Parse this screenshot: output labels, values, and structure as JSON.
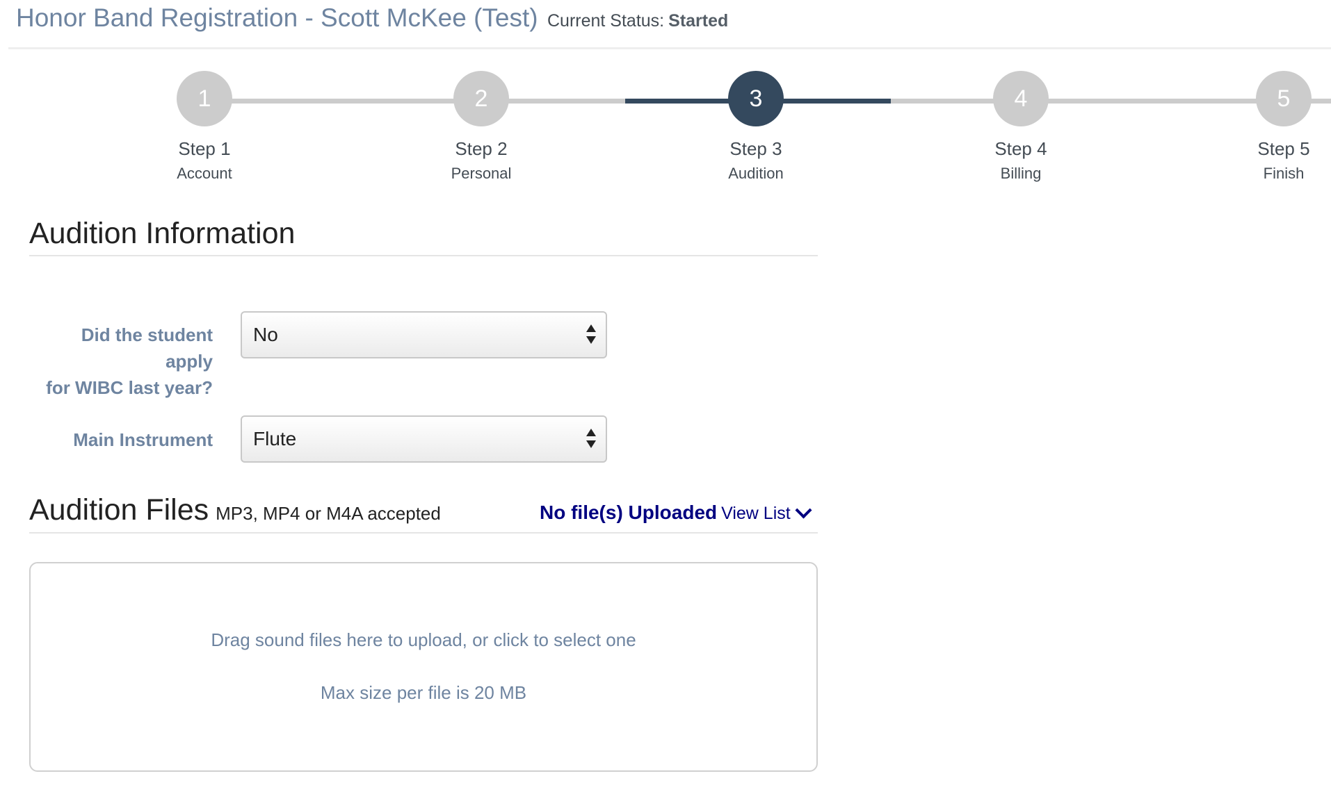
{
  "header": {
    "title": "Honor Band Registration - Scott McKee (Test)",
    "status_label": "Current Status:",
    "status_value": "Started"
  },
  "steps": [
    {
      "number": "1",
      "title": "Step 1",
      "subtitle": "Account",
      "active": false
    },
    {
      "number": "2",
      "title": "Step 2",
      "subtitle": "Personal",
      "active": false
    },
    {
      "number": "3",
      "title": "Step 3",
      "subtitle": "Audition",
      "active": true
    },
    {
      "number": "4",
      "title": "Step 4",
      "subtitle": "Billing",
      "active": false
    },
    {
      "number": "5",
      "title": "Step 5",
      "subtitle": "Finish",
      "active": false
    }
  ],
  "audition_info": {
    "heading": "Audition Information",
    "applied_last_year": {
      "label_line1": "Did the student",
      "label_line2": "apply",
      "label_line3": "for WIBC last year?",
      "value": "No"
    },
    "main_instrument": {
      "label": "Main Instrument",
      "value": "Flute"
    }
  },
  "audition_files": {
    "heading": "Audition Files",
    "accepted": "MP3, MP4 or M4A accepted",
    "status": "No file(s) Uploaded",
    "view_list": "View List",
    "dropzone_text": "Drag sound files here to upload, or click to select one",
    "max_size_text": "Max size per file is 20 MB"
  },
  "colors": {
    "accent": "#34495e",
    "inactive_step": "#cccccc",
    "label": "#6e84a0",
    "status_link": "#000080"
  }
}
